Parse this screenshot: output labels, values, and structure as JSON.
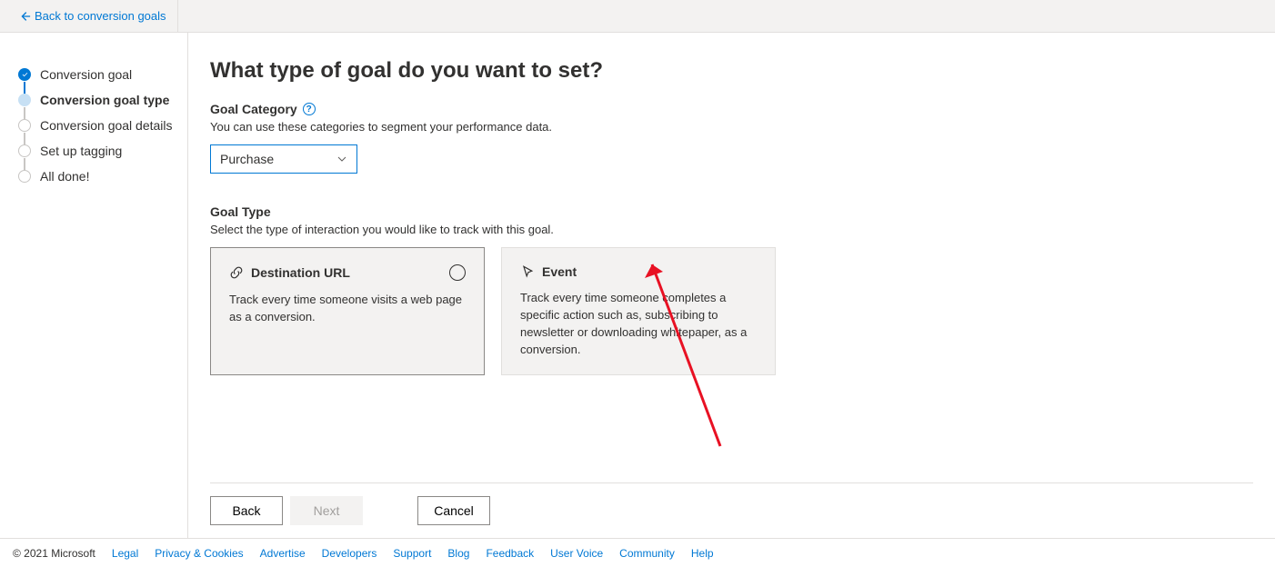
{
  "topbar": {
    "back": "Back to conversion goals"
  },
  "steps": [
    {
      "label": "Conversion goal"
    },
    {
      "label": "Conversion goal type"
    },
    {
      "label": "Conversion goal details"
    },
    {
      "label": "Set up tagging"
    },
    {
      "label": "All done!"
    }
  ],
  "main": {
    "heading": "What type of goal do you want to set?",
    "category": {
      "label": "Goal Category",
      "desc": "You can use these categories to segment your performance data.",
      "value": "Purchase"
    },
    "type": {
      "label": "Goal Type",
      "desc": "Select the type of interaction you would like to track with this goal."
    },
    "cards": [
      {
        "title": "Destination URL",
        "desc": "Track every time someone visits a web page as a conversion."
      },
      {
        "title": "Event",
        "desc": "Track every time someone completes a specific action such as, subscribing to newsletter or downloading whitepaper, as a conversion."
      }
    ],
    "buttons": {
      "back": "Back",
      "next": "Next",
      "cancel": "Cancel"
    }
  },
  "footer": {
    "copy": "© 2021 Microsoft",
    "links": [
      "Legal",
      "Privacy & Cookies",
      "Advertise",
      "Developers",
      "Support",
      "Blog",
      "Feedback",
      "User Voice",
      "Community",
      "Help"
    ]
  }
}
